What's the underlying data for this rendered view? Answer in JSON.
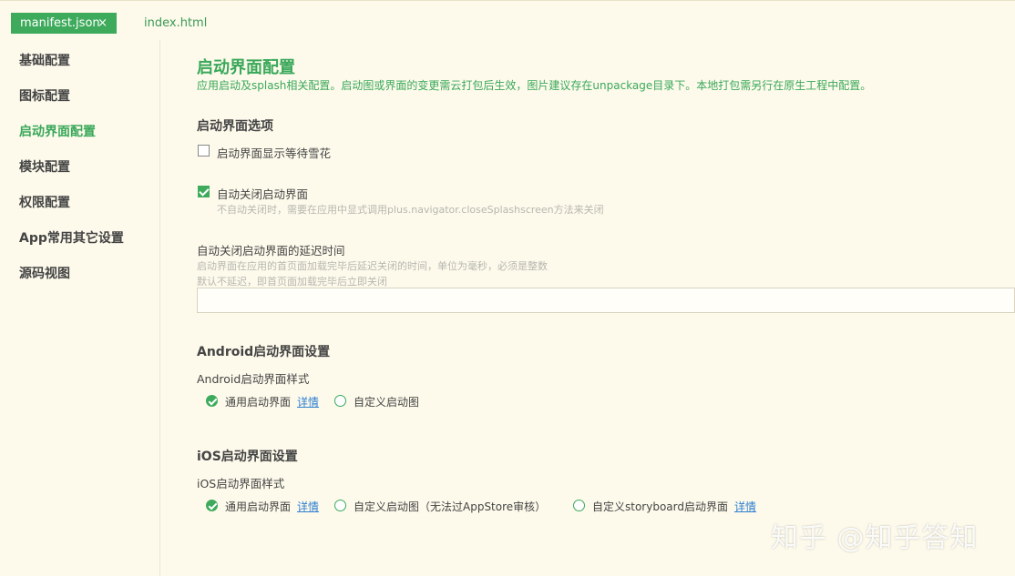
{
  "tabs": {
    "active": "manifest.json",
    "close_glyph": "×",
    "inactive": "index.html"
  },
  "sidebar": {
    "items": [
      {
        "label": "基础配置"
      },
      {
        "label": "图标配置"
      },
      {
        "label": "启动界面配置",
        "active": true
      },
      {
        "label": "模块配置"
      },
      {
        "label": "权限配置"
      },
      {
        "label": "App常用其它设置"
      },
      {
        "label": "源码视图"
      }
    ]
  },
  "main": {
    "title": "启动界面配置",
    "subtitle": "应用启动及splash相关配置。启动图或界面的变更需云打包后生效，图片建议存在unpackage目录下。本地打包需另行在原生工程中配置。",
    "options_heading": "启动界面选项",
    "waiting_checkbox": {
      "label": "启动界面显示等待雪花",
      "checked": false
    },
    "autoclose_checkbox": {
      "label": "自动关闭启动界面",
      "checked": true,
      "hint": "不自动关闭时，需要在应用中显式调用plus.navigator.closeSplashscreen方法来关闭"
    },
    "delay": {
      "label": "自动关闭启动界面的延迟时间",
      "hint1": "启动界面在应用的首页面加载完毕后延迟关闭的时间，单位为毫秒，必须是整数",
      "hint2": "默认不延迟，即首页面加载完毕后立即关闭",
      "value": ""
    },
    "android": {
      "heading": "Android启动界面设置",
      "style_label": "Android启动界面样式",
      "options": [
        {
          "label": "通用启动界面",
          "checked": true,
          "link": "详情"
        },
        {
          "label": "自定义启动图",
          "checked": false
        }
      ]
    },
    "ios": {
      "heading": "iOS启动界面设置",
      "style_label": "iOS启动界面样式",
      "options": [
        {
          "label": "通用启动界面",
          "checked": true,
          "link": "详情"
        },
        {
          "label": "自定义启动图（无法过AppStore审核）",
          "checked": false
        },
        {
          "label": "自定义storyboard启动界面",
          "checked": false,
          "link": "详情"
        }
      ]
    }
  },
  "watermark": "知乎 @知乎答知",
  "colors": {
    "accent": "#3eab5c",
    "background": "#fdfaeb",
    "link": "#2f7fd1"
  }
}
